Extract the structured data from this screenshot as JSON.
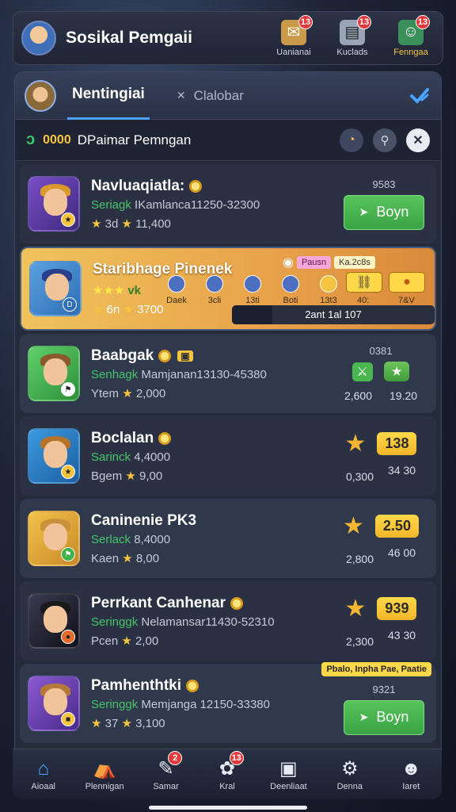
{
  "header": {
    "title": "Sosikal Pemgaii",
    "actions": [
      {
        "label": "Uanianai",
        "badge": "13",
        "icon": "mail-icon",
        "gold": false
      },
      {
        "label": "Kuclads",
        "badge": "13",
        "icon": "cards-icon",
        "gold": false
      },
      {
        "label": "Fenngaa",
        "badge": "13",
        "icon": "profile-icon",
        "gold": true
      }
    ]
  },
  "tabs": {
    "active": "Nentingiai",
    "inactive": "Clalobar"
  },
  "filter": {
    "count": "0000",
    "title": "DPaimar Pemngan"
  },
  "rows": [
    {
      "title": "Navluaqiatla:",
      "sub_green": "Seriagk",
      "sub_grey": "IKamlanca11250-32300",
      "meta_left": "3d",
      "meta_right": "11,400",
      "small_num": "9583",
      "button": "Boyn",
      "icon_bg": "#7a4cc9",
      "hair": "#d99a2b"
    },
    {
      "title": "Staribhage Pinenek",
      "stars": "★★★",
      "vk": "vk",
      "meta_left": "6n",
      "meta_right": "3700",
      "tags": [
        "Pausn",
        "Ka.2c8s"
      ],
      "cols": [
        "Daek",
        "3cli",
        "13ti",
        "Boti",
        "13t3"
      ],
      "btn_vals": [
        "40:",
        "7&V"
      ],
      "progress_text": "2ant 1al 107",
      "progress": 0.2,
      "icon_bg": "#2f6fb5",
      "hair": "#2a3f8c"
    },
    {
      "title": "Baabgak",
      "sub_green": "Senhagk",
      "sub_grey": "Mamjanan13130-45380",
      "meta_left": "Ytem",
      "meta_right": "2,000",
      "small_num": "0381",
      "under_left": "2,600",
      "pill": "19.20",
      "icon_bg": "#3fb34a",
      "hair": "#8a5a2a"
    },
    {
      "title": "Boclalan",
      "sub_green": "Sarinck",
      "sub_grey": "4,4000",
      "meta_left": "Bgem",
      "meta_right": "9,00",
      "pill": "138",
      "under_right": "34 30",
      "under_left": "0,300",
      "icon_bg": "#2a7fc9",
      "hair": "#b5722a"
    },
    {
      "title": "Caninenie PK3",
      "sub_green": "Serlack",
      "sub_grey": "8,4000",
      "meta_left": "Kaen",
      "meta_right": "8,00",
      "pill": "2.50",
      "under_right": "46 00",
      "under_left": "2,800",
      "icon_bg": "#e0a436",
      "hair": "#c9923a"
    },
    {
      "title": "Perrkant Canhenar",
      "sub_green": "Seringgk",
      "sub_grey": "Nelamansar11430-52310",
      "meta_left": "Pcen",
      "meta_right": "2,00",
      "pill": "939",
      "under_right": "43 30",
      "under_left": "2,300",
      "icon_bg": "#1d1d2a",
      "hair": "#1a1a1a"
    },
    {
      "title": "Pamhenthtki",
      "sub_green": "Seringgk",
      "sub_grey": "Memjanga 12150-33380",
      "meta_left": "37",
      "meta_right": "3,100",
      "small_num": "9321",
      "button": "Boyn",
      "tooltip": "Pbalo, Inpha Pae, Paatie",
      "icon_bg": "#6a3fb5",
      "hair": "#b57a3a"
    }
  ],
  "nav": [
    {
      "label": "Aioaal",
      "icon": "home-icon",
      "active": true,
      "badge": ""
    },
    {
      "label": "Plennigan",
      "icon": "bag-icon",
      "active": false,
      "badge": ""
    },
    {
      "label": "Samar",
      "icon": "chat-icon",
      "active": false,
      "badge": "2"
    },
    {
      "label": "Kral",
      "icon": "gear-icon",
      "active": false,
      "badge": "13"
    },
    {
      "label": "Deenliaat",
      "icon": "screen-icon",
      "active": false,
      "badge": ""
    },
    {
      "label": "Denna",
      "icon": "settings-icon",
      "active": false,
      "badge": ""
    },
    {
      "label": "Iaret",
      "icon": "user-icon",
      "active": false,
      "badge": ""
    }
  ],
  "colors": {
    "accent": "#4aa3ff",
    "buy": "#4ab64f",
    "gold": "#f5c542",
    "highlight": "#e8a24a"
  }
}
